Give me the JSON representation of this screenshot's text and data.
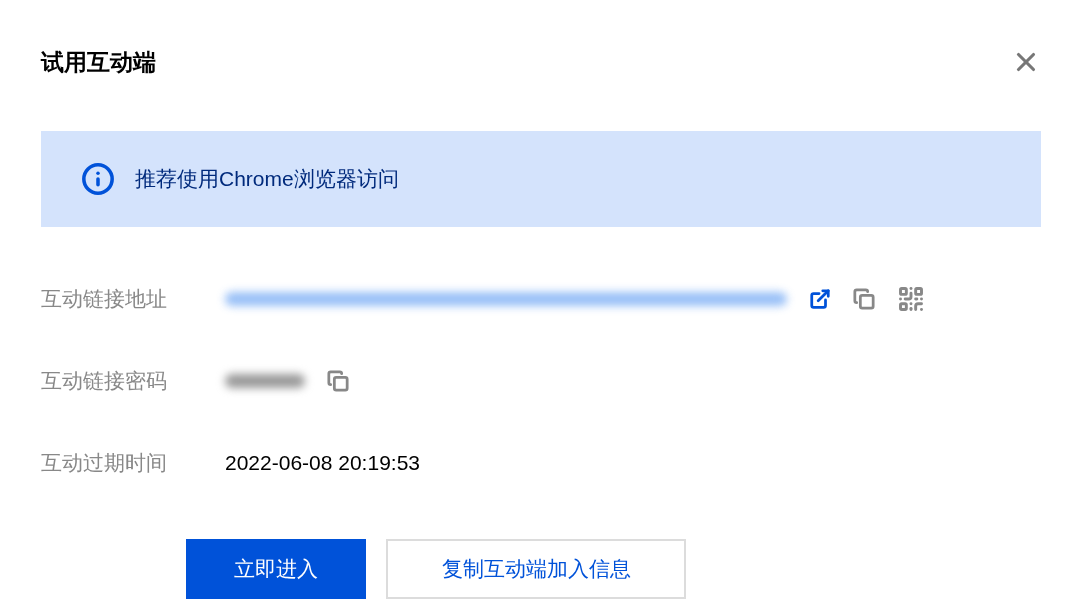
{
  "dialog": {
    "title": "试用互动端"
  },
  "notice": {
    "text": "推荐使用Chrome浏览器访问"
  },
  "fields": [
    {
      "label": "互动链接地址",
      "kind": "link"
    },
    {
      "label": "互动链接密码",
      "kind": "secret"
    },
    {
      "label": "互动过期时间",
      "kind": "text",
      "value": "2022-06-08 20:19:53"
    }
  ],
  "buttons": [
    {
      "label": "立即进入",
      "kind": "primary"
    },
    {
      "label": "复制互动端加入信息",
      "kind": "secondary"
    }
  ]
}
